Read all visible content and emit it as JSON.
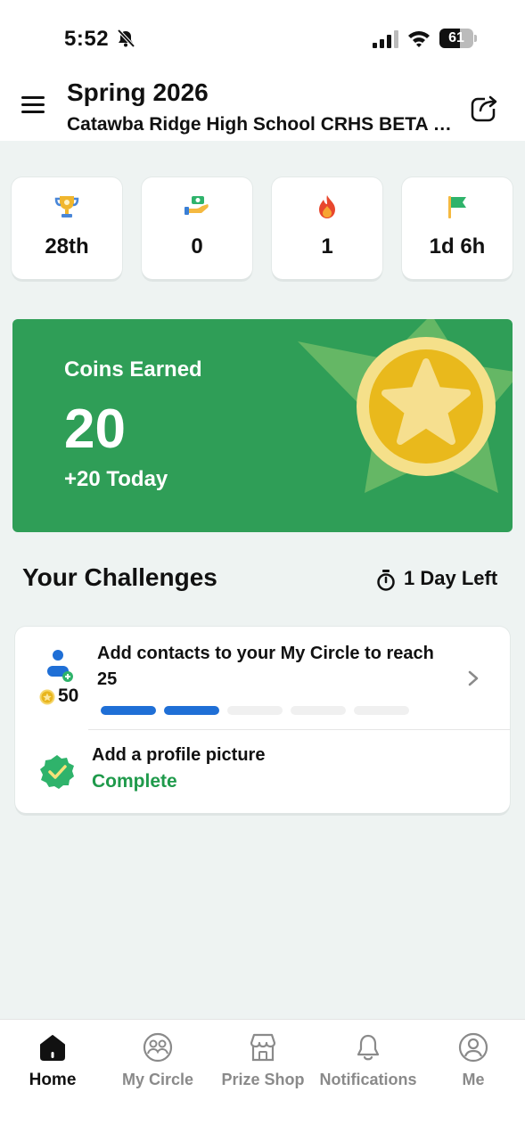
{
  "status_bar": {
    "time": "5:52",
    "battery": "61",
    "battery_level": 0.61
  },
  "header": {
    "title": "Spring 2026",
    "subtitle": "Catawba Ridge High School CRHS BETA Club"
  },
  "stats": [
    {
      "icon": "trophy-icon",
      "value": "28th"
    },
    {
      "icon": "hand-money-icon",
      "value": "0"
    },
    {
      "icon": "flame-icon",
      "value": "1"
    },
    {
      "icon": "flag-icon",
      "value": "1d 6h"
    }
  ],
  "coins": {
    "label": "Coins Earned",
    "value": "20",
    "today": "+20 Today"
  },
  "challenges": {
    "title": "Your Challenges",
    "time_left": "1 Day Left",
    "items": [
      {
        "text": "Add contacts to your My Circle to reach 25",
        "reward": "50",
        "progress_filled": 2,
        "progress_total": 5
      },
      {
        "text": "Add a profile picture",
        "status": "Complete"
      }
    ]
  },
  "tabs": [
    {
      "label": "Home",
      "icon": "home-icon",
      "active": true
    },
    {
      "label": "My Circle",
      "icon": "group-icon"
    },
    {
      "label": "Prize Shop",
      "icon": "shop-icon"
    },
    {
      "label": "Notifications",
      "icon": "bell-icon"
    },
    {
      "label": "Me",
      "icon": "person-icon"
    }
  ],
  "colors": {
    "green": "#2f9e57",
    "accent_blue": "#1f6fd6",
    "complete_green": "#1f9a4b",
    "background": "#eef3f2"
  }
}
